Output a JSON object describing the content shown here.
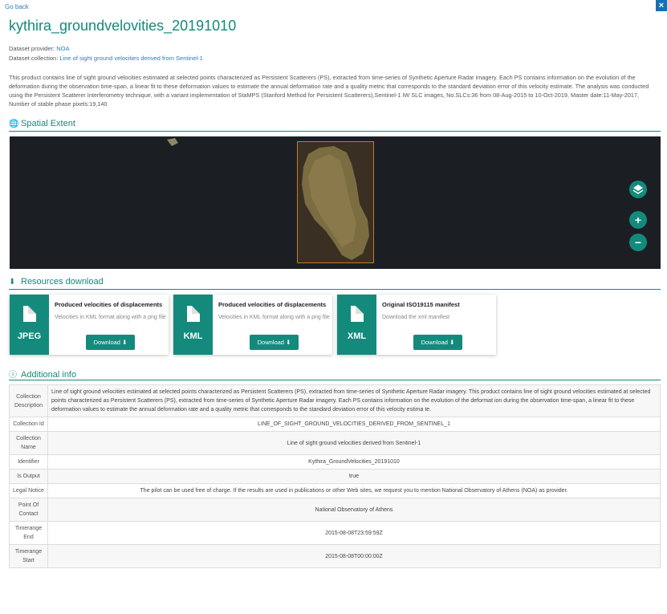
{
  "nav": {
    "go_back": "Go back",
    "close": "×"
  },
  "header": {
    "title": "kythira_groundvelovities_20191010",
    "provider_label": "Dataset provider:",
    "provider": "NOA",
    "collection_label": "Dataset collection:",
    "collection": "Line of sight ground velocities derived from Sentinel-1"
  },
  "description": "This product contains line of sight ground velocities estimated at selected points characterized as Persistent Scatterers (PS), extracted from time-series of Synthetic Aperture Radar imagery. Each PS contains information on the evolution of the deformation during the observation time-span, a linear fit to these deformation values to estimate the annual deformation rate and a quality metric that corresponds to the standard deviation error of this velocity estimate. The analysis was conducted using the Persistent Scatterer Interferometry technique, with a variant implementation of StaMPS (Stanford Method for Persistent Scatterers),Sentinel-1 IW SLC images, No.SLCs:36 from 08-Aug-2015 to 10-Oct-2019, Master date:11-May-2017, Number of stable phase pixels:19,140",
  "sections": {
    "spatial": "Spatial Extent",
    "resources": "Resources download",
    "additional": "Additional info"
  },
  "map": {
    "layers_icon": "layers-icon",
    "zoom_in": "+",
    "zoom_out": "−"
  },
  "resources": [
    {
      "format": "JPEG",
      "title": "Produced velocities of displacements",
      "subtitle": "Velocities in KML format along with a png file",
      "button": "Download"
    },
    {
      "format": "KML",
      "title": "Produced velocities of displacements",
      "subtitle": "Velocities in KML format along with a png file",
      "button": "Download"
    },
    {
      "format": "XML",
      "title": "Original ISO19115 manifest",
      "subtitle": "Download the xml manifest",
      "button": "Download"
    }
  ],
  "info": [
    {
      "key": "Collection Description",
      "value": "Line of sight ground velocities estimated at selected points characterized as Persistent Scatterers (PS), extracted from time-series of Synthetic Aperture Radar imagery. This product contains line of sight ground velocities estimated at selected points characterized as Persistent Scatterers (PS), extracted from time-series of Synthetic Aperture Radar imagery. Each PS contains information on the evolution of the deformat ion during the observation time-span, a linear fit to these deformation values to estimate the annual deformation rate and a quality metric that corresponds to the standard deviation error of this velocity estima te."
    },
    {
      "key": "Collection Id",
      "value": "LINE_OF_SIGHT_GROUND_VELOCITIES_DERIVED_FROM_SENTINEL_1"
    },
    {
      "key": "Collection Name",
      "value": "Line of sight ground velocities derived from Sentinel-1"
    },
    {
      "key": "Identifier",
      "value": "Kythira_GroundVelocities_20191010"
    },
    {
      "key": "Is Output",
      "value": "true"
    },
    {
      "key": "Legal Notice",
      "value": "The pilot can be used free of charge. If the results are used in publications or other Web sites, we request you to mention National Observatory of Athens (NOA) as provider."
    },
    {
      "key": "Point Of Contact",
      "value": "National Observatory of Athens"
    },
    {
      "key": "Timerange End",
      "value": "2015-08-08T23:59:59Z"
    },
    {
      "key": "Timerange Start",
      "value": "2015-08-08T00:00:00Z"
    }
  ]
}
